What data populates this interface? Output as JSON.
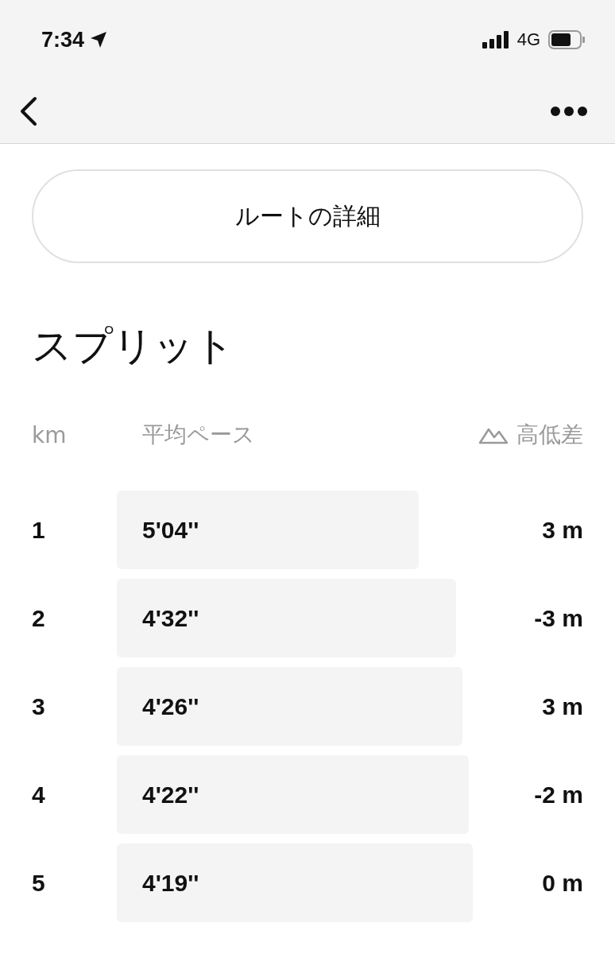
{
  "status_bar": {
    "time": "7:34",
    "network": "4G"
  },
  "route_button": {
    "label": "ルートの詳細"
  },
  "section_title": "スプリット",
  "columns": {
    "km": "km",
    "pace": "平均ペース",
    "elevation": "高低差"
  },
  "splits": [
    {
      "km": "1",
      "pace": "5'04''",
      "elevation": "3 m"
    },
    {
      "km": "2",
      "pace": "4'32''",
      "elevation": "-3 m"
    },
    {
      "km": "3",
      "pace": "4'26''",
      "elevation": "3 m"
    },
    {
      "km": "4",
      "pace": "4'22''",
      "elevation": "-2 m"
    },
    {
      "km": "5",
      "pace": "4'19''",
      "elevation": "0 m"
    }
  ]
}
